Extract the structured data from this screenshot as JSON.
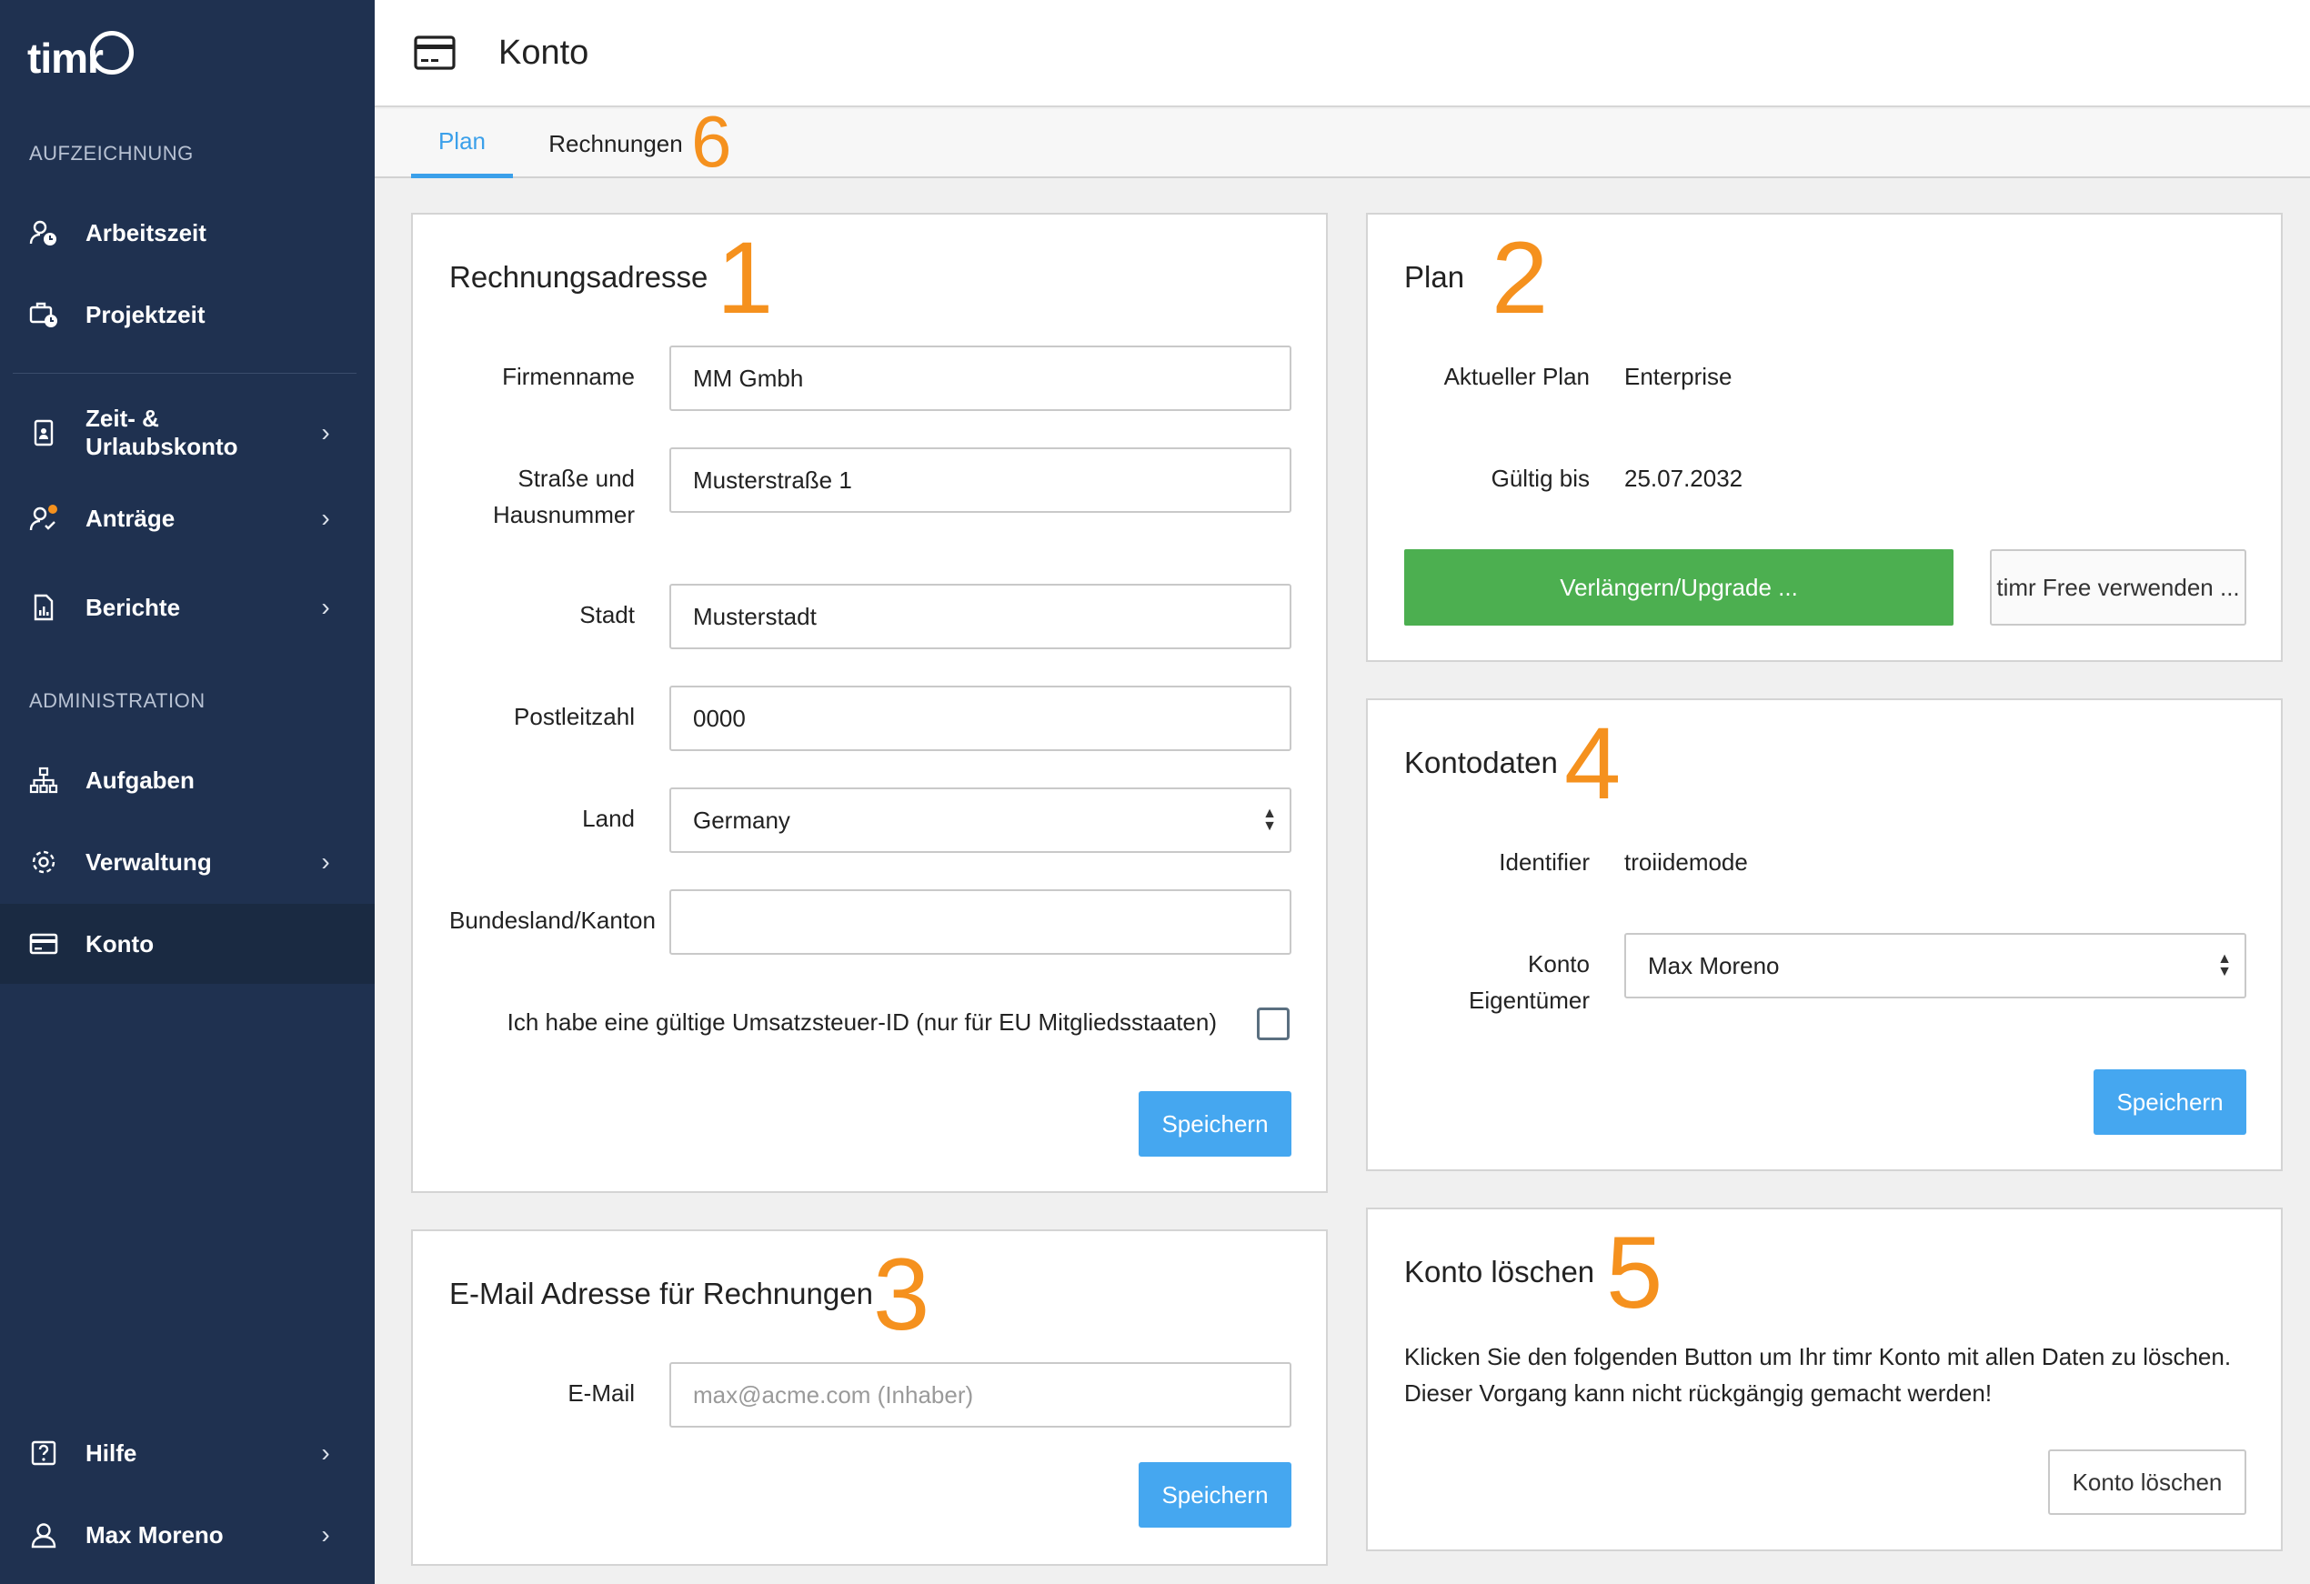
{
  "app": {
    "logo_text": "timr"
  },
  "sidebar": {
    "section_recording": "AUFZEICHNUNG",
    "section_admin": "ADMINISTRATION",
    "items": [
      {
        "label": "Arbeitszeit"
      },
      {
        "label": "Projektzeit"
      },
      {
        "label": "Zeit- & Urlaubskonto"
      },
      {
        "label": "Anträge"
      },
      {
        "label": "Berichte"
      },
      {
        "label": "Aufgaben"
      },
      {
        "label": "Verwaltung"
      },
      {
        "label": "Konto"
      },
      {
        "label": "Hilfe"
      },
      {
        "label": "Max Moreno"
      }
    ],
    "chevron": "›",
    "accent_dot_color": "#f5911e"
  },
  "header": {
    "title": "Konto"
  },
  "tabs": [
    {
      "label": "Plan"
    },
    {
      "label": "Rechnungen"
    }
  ],
  "annotations": {
    "a1": "1",
    "a2": "2",
    "a3": "3",
    "a4": "4",
    "a5": "5",
    "a6": "6"
  },
  "billing_address": {
    "title": "Rechnungsadresse",
    "company_label": "Firmenname",
    "company_value": "MM Gmbh",
    "street_label_line1": "Straße und",
    "street_label_line2": "Hausnummer",
    "street_value": "Musterstraße 1",
    "city_label": "Stadt",
    "city_value": "Musterstadt",
    "zip_label": "Postleitzahl",
    "zip_value": "0000",
    "country_label": "Land",
    "country_value": "Germany",
    "state_label": "Bundesland/Kanton",
    "state_value": "",
    "vat_label": "Ich habe eine gültige Umsatzsteuer-ID (nur für EU Mitgliedsstaaten)",
    "save_label": "Speichern"
  },
  "plan": {
    "title": "Plan",
    "current_label": "Aktueller Plan",
    "current_value": "Enterprise",
    "valid_label": "Gültig bis",
    "valid_value": "25.07.2032",
    "upgrade_label": "Verlängern/Upgrade ...",
    "free_label": "timr Free verwenden ..."
  },
  "billing_email": {
    "title": "E-Mail Adresse für Rechnungen",
    "email_label": "E-Mail",
    "email_placeholder": "max@acme.com (Inhaber)",
    "save_label": "Speichern"
  },
  "account_data": {
    "title": "Kontodaten",
    "identifier_label": "Identifier",
    "identifier_value": "troiidemode",
    "owner_label_line1": "Konto",
    "owner_label_line2": "Eigentümer",
    "owner_value": "Max Moreno",
    "save_label": "Speichern"
  },
  "delete_account": {
    "title": "Konto löschen",
    "text_line1": "Klicken Sie den folgenden Button um Ihr timr Konto mit allen Daten zu löschen.",
    "text_line2": "Dieser Vorgang kann nicht rückgängig gemacht werden!",
    "button_label": "Konto löschen"
  }
}
